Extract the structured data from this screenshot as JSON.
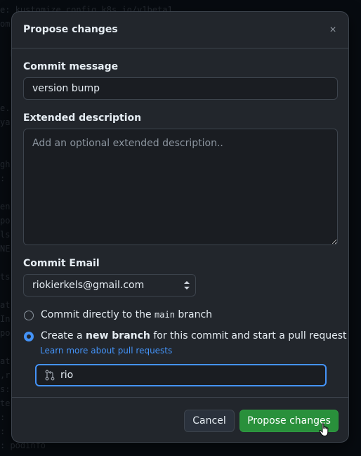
{
  "background_code": [
    "e: kustomize.config.k8s.io/v1beta1",
    "om",
    "  p",
    "e.",
    "ya",
    "gh",
    ": ",
    "en",
    "po",
    "ls",
    "NE",
    "ts",
    "at",
    "In",
    "po",
    "at",
    ",r",
    "s:",
    "te",
    ":",
    ":",
    ": podinfo"
  ],
  "dialog": {
    "title": "Propose changes",
    "close_label": "×"
  },
  "commit_message": {
    "label": "Commit message",
    "value": "version bump"
  },
  "extended_description": {
    "label": "Extended description",
    "placeholder": "Add an optional extended description.."
  },
  "commit_email": {
    "label": "Commit Email",
    "selected": "riokierkels@gmail.com"
  },
  "options": {
    "direct": {
      "prefix": "Commit directly to the ",
      "branch": "main",
      "suffix": " branch",
      "checked": false
    },
    "new_branch": {
      "prefix": "Create a ",
      "bold": "new branch",
      "suffix": " for this commit and start a pull request",
      "checked": true
    },
    "learn_more": "Learn more about pull requests"
  },
  "branch_name": {
    "value": "rio",
    "icon": "git-pull-request-icon"
  },
  "footer": {
    "cancel_label": "Cancel",
    "propose_label": "Propose changes"
  },
  "colors": {
    "accent": "#4493f8",
    "primary_button": "#29903b",
    "dialog_bg": "#22262c",
    "border": "#3d444d"
  }
}
